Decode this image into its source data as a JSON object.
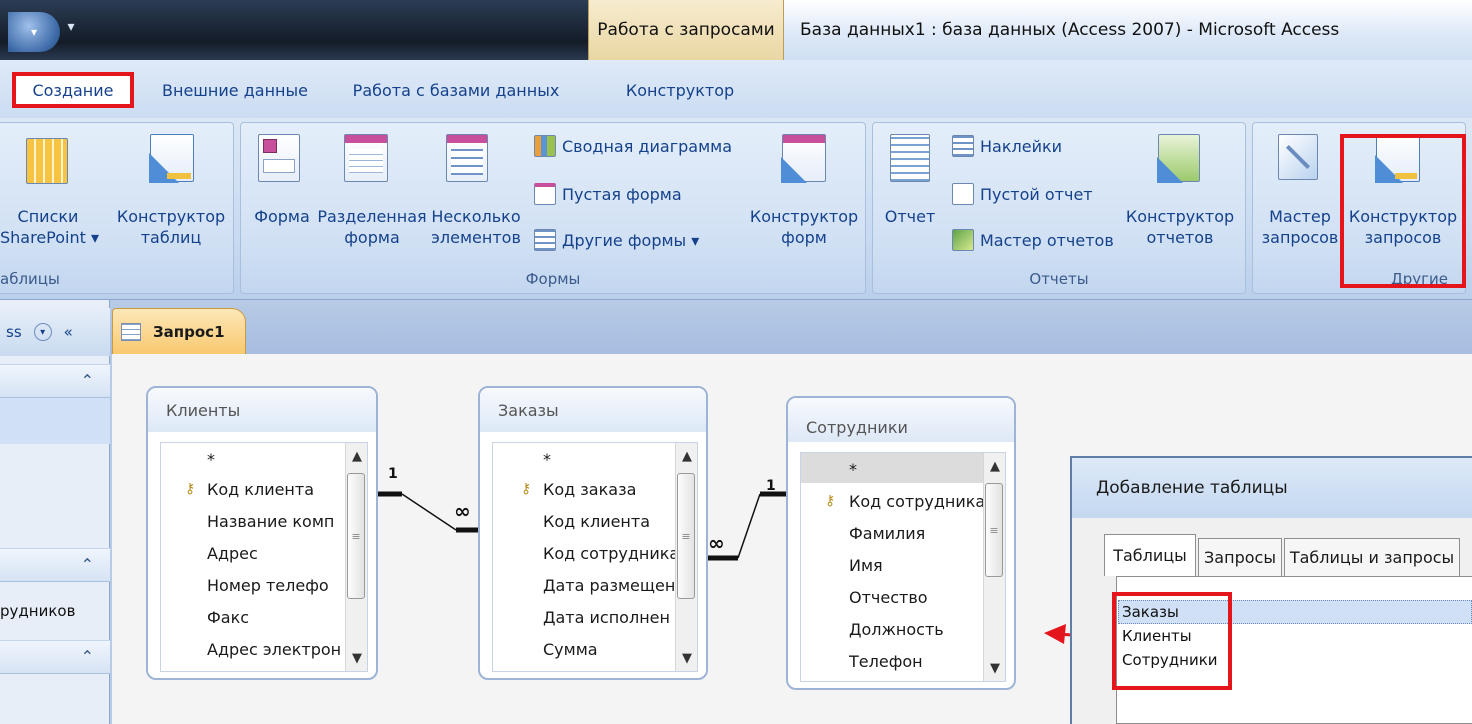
{
  "titlebar": {
    "context_tab": "Работа с запросами",
    "window_title": "База данных1 : база данных (Access 2007) - Microsoft Access"
  },
  "tabs": [
    "Создание",
    "Внешние данные",
    "Работа с базами данных",
    "Конструктор"
  ],
  "ribbon": {
    "tables": {
      "label": "аблицы",
      "b1a": "Списки",
      "b1b": "SharePoint ▾",
      "b2a": "Конструктор",
      "b2b": "таблиц"
    },
    "forms": {
      "label": "Формы",
      "form": "Форма",
      "split_a": "Разделенная",
      "split_b": "форма",
      "multi_a": "Несколько",
      "multi_b": "элементов",
      "pivot": "Сводная диаграмма",
      "blank": "Пустая форма",
      "other": "Другие формы ▾",
      "design_a": "Конструктор",
      "design_b": "форм"
    },
    "reports": {
      "label": "Отчеты",
      "report": "Отчет",
      "labels": "Наклейки",
      "blank": "Пустой отчет",
      "wizard": "Мастер отчетов",
      "design_a": "Конструктор",
      "design_b": "отчетов"
    },
    "other": {
      "label": "Другие",
      "wizard_a": "Мастер",
      "wizard_b": "запросов",
      "design_a": "Конструктор",
      "design_b": "запросов"
    }
  },
  "nav": {
    "head_text": "ss",
    "item": "рудников"
  },
  "doc_tab": "Запрос1",
  "tables": {
    "t1": {
      "title": "Клиенты",
      "fields": [
        "*",
        "Код клиента",
        "Название комп",
        "Адрес",
        "Номер телефо",
        "Факс",
        "Адрес электрон"
      ]
    },
    "t2": {
      "title": "Заказы",
      "fields": [
        "*",
        "Код заказа",
        "Код клиента",
        "Код сотрудника",
        "Дата размещен",
        "Дата исполнен",
        "Сумма"
      ]
    },
    "t3": {
      "title": "Сотрудники",
      "fields": [
        "*",
        "Код сотрудника",
        "Фамилия",
        "Имя",
        "Отчество",
        "Должность",
        "Телефон"
      ]
    }
  },
  "relations": {
    "one": "1",
    "many": "∞"
  },
  "dialog": {
    "title": "Добавление таблицы",
    "tabs": [
      "Таблицы",
      "Запросы",
      "Таблицы и запросы"
    ],
    "items": [
      "Заказы",
      "Клиенты",
      "Сотрудники"
    ]
  },
  "colors": {
    "highlight": "#e4161b",
    "ribbon": "#c7d9f0",
    "selection": "#cfe0f7"
  }
}
